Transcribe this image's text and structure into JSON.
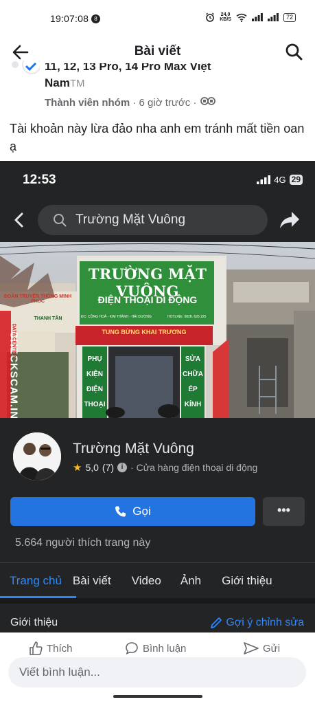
{
  "status_bar": {
    "time": "19:07:08",
    "notification_count": "8",
    "net_speed_value": "24,0",
    "net_speed_unit": "KB/S",
    "battery": "72"
  },
  "header": {
    "title": "Bài viết"
  },
  "post": {
    "group_name_line1": "11, 12, 13 Pro, 14 Pro Max Việt",
    "group_name_line2": "Nam",
    "group_name_suffix": "TM",
    "role": "Thành viên nhóm",
    "time_ago": "· 6 giờ trước ·",
    "text": "Tài khoản này lừa đảo nha anh em tránh mất tiền oan ạ"
  },
  "screenshot": {
    "status_time": "12:53",
    "network": "4G",
    "battery": "29",
    "search_text": "Trường Mặt Vuông",
    "cover": {
      "sign_title": "TRƯỜNG MẶT VUÔNG",
      "sign_sub": "ĐIỆN THOẠI DI ĐỘNG",
      "sign_address": "ĐC: CỘNG HOÀ - KIM THÀNH - HẢI DƯƠNG",
      "sign_hotline": "HOTLINE: 0828. 626 225",
      "banner": "TUNG BỪNG KHAI TRƯƠNG",
      "left_pillar": [
        "PHỤ",
        "KIỆN",
        "ĐIỆN",
        "THOẠI"
      ],
      "right_pillar": [
        "SỬA",
        "CHỮA",
        "ÉP",
        "KÍNH"
      ],
      "left_sign_1": "ĐOÀN TRUYỀN THÔNG MINH PHÚC",
      "left_sign_2": "THANH TÂN",
      "watermark_top": "DATA CENTER",
      "watermark_main": "CHECKSCAM.INFO"
    },
    "page": {
      "name": "Trường Mặt Vuông",
      "rating": "5,0",
      "rating_count": "(7)",
      "category": "· Cửa hàng điện thoại di động",
      "call_label": "Gọi",
      "more_label": "•••",
      "likes": "5.664 người thích trang này"
    },
    "tabs": [
      "Trang chủ",
      "Bài viết",
      "Video",
      "Ảnh",
      "Giới thiệu"
    ],
    "intro_label": "Giới thiệu",
    "edit_label": "Gợi ý chỉnh sửa"
  },
  "actions": {
    "like": "Thích",
    "comment": "Bình luận",
    "share": "Gửi"
  },
  "comment_placeholder": "Viết bình luận..."
}
